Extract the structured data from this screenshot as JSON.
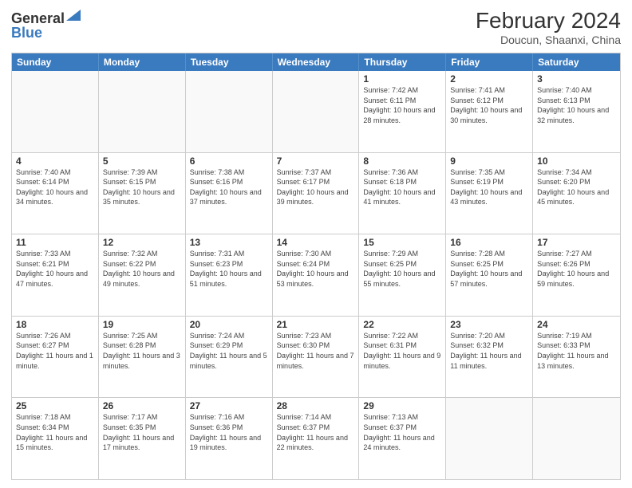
{
  "header": {
    "logo": {
      "general": "General",
      "blue": "Blue"
    },
    "title": "February 2024",
    "location": "Doucun, Shaanxi, China"
  },
  "days_of_week": [
    "Sunday",
    "Monday",
    "Tuesday",
    "Wednesday",
    "Thursday",
    "Friday",
    "Saturday"
  ],
  "weeks": [
    [
      {
        "day": "",
        "info": ""
      },
      {
        "day": "",
        "info": ""
      },
      {
        "day": "",
        "info": ""
      },
      {
        "day": "",
        "info": ""
      },
      {
        "day": "1",
        "info": "Sunrise: 7:42 AM\nSunset: 6:11 PM\nDaylight: 10 hours and 28 minutes."
      },
      {
        "day": "2",
        "info": "Sunrise: 7:41 AM\nSunset: 6:12 PM\nDaylight: 10 hours and 30 minutes."
      },
      {
        "day": "3",
        "info": "Sunrise: 7:40 AM\nSunset: 6:13 PM\nDaylight: 10 hours and 32 minutes."
      }
    ],
    [
      {
        "day": "4",
        "info": "Sunrise: 7:40 AM\nSunset: 6:14 PM\nDaylight: 10 hours and 34 minutes."
      },
      {
        "day": "5",
        "info": "Sunrise: 7:39 AM\nSunset: 6:15 PM\nDaylight: 10 hours and 35 minutes."
      },
      {
        "day": "6",
        "info": "Sunrise: 7:38 AM\nSunset: 6:16 PM\nDaylight: 10 hours and 37 minutes."
      },
      {
        "day": "7",
        "info": "Sunrise: 7:37 AM\nSunset: 6:17 PM\nDaylight: 10 hours and 39 minutes."
      },
      {
        "day": "8",
        "info": "Sunrise: 7:36 AM\nSunset: 6:18 PM\nDaylight: 10 hours and 41 minutes."
      },
      {
        "day": "9",
        "info": "Sunrise: 7:35 AM\nSunset: 6:19 PM\nDaylight: 10 hours and 43 minutes."
      },
      {
        "day": "10",
        "info": "Sunrise: 7:34 AM\nSunset: 6:20 PM\nDaylight: 10 hours and 45 minutes."
      }
    ],
    [
      {
        "day": "11",
        "info": "Sunrise: 7:33 AM\nSunset: 6:21 PM\nDaylight: 10 hours and 47 minutes."
      },
      {
        "day": "12",
        "info": "Sunrise: 7:32 AM\nSunset: 6:22 PM\nDaylight: 10 hours and 49 minutes."
      },
      {
        "day": "13",
        "info": "Sunrise: 7:31 AM\nSunset: 6:23 PM\nDaylight: 10 hours and 51 minutes."
      },
      {
        "day": "14",
        "info": "Sunrise: 7:30 AM\nSunset: 6:24 PM\nDaylight: 10 hours and 53 minutes."
      },
      {
        "day": "15",
        "info": "Sunrise: 7:29 AM\nSunset: 6:25 PM\nDaylight: 10 hours and 55 minutes."
      },
      {
        "day": "16",
        "info": "Sunrise: 7:28 AM\nSunset: 6:25 PM\nDaylight: 10 hours and 57 minutes."
      },
      {
        "day": "17",
        "info": "Sunrise: 7:27 AM\nSunset: 6:26 PM\nDaylight: 10 hours and 59 minutes."
      }
    ],
    [
      {
        "day": "18",
        "info": "Sunrise: 7:26 AM\nSunset: 6:27 PM\nDaylight: 11 hours and 1 minute."
      },
      {
        "day": "19",
        "info": "Sunrise: 7:25 AM\nSunset: 6:28 PM\nDaylight: 11 hours and 3 minutes."
      },
      {
        "day": "20",
        "info": "Sunrise: 7:24 AM\nSunset: 6:29 PM\nDaylight: 11 hours and 5 minutes."
      },
      {
        "day": "21",
        "info": "Sunrise: 7:23 AM\nSunset: 6:30 PM\nDaylight: 11 hours and 7 minutes."
      },
      {
        "day": "22",
        "info": "Sunrise: 7:22 AM\nSunset: 6:31 PM\nDaylight: 11 hours and 9 minutes."
      },
      {
        "day": "23",
        "info": "Sunrise: 7:20 AM\nSunset: 6:32 PM\nDaylight: 11 hours and 11 minutes."
      },
      {
        "day": "24",
        "info": "Sunrise: 7:19 AM\nSunset: 6:33 PM\nDaylight: 11 hours and 13 minutes."
      }
    ],
    [
      {
        "day": "25",
        "info": "Sunrise: 7:18 AM\nSunset: 6:34 PM\nDaylight: 11 hours and 15 minutes."
      },
      {
        "day": "26",
        "info": "Sunrise: 7:17 AM\nSunset: 6:35 PM\nDaylight: 11 hours and 17 minutes."
      },
      {
        "day": "27",
        "info": "Sunrise: 7:16 AM\nSunset: 6:36 PM\nDaylight: 11 hours and 19 minutes."
      },
      {
        "day": "28",
        "info": "Sunrise: 7:14 AM\nSunset: 6:37 PM\nDaylight: 11 hours and 22 minutes."
      },
      {
        "day": "29",
        "info": "Sunrise: 7:13 AM\nSunset: 6:37 PM\nDaylight: 11 hours and 24 minutes."
      },
      {
        "day": "",
        "info": ""
      },
      {
        "day": "",
        "info": ""
      }
    ]
  ]
}
